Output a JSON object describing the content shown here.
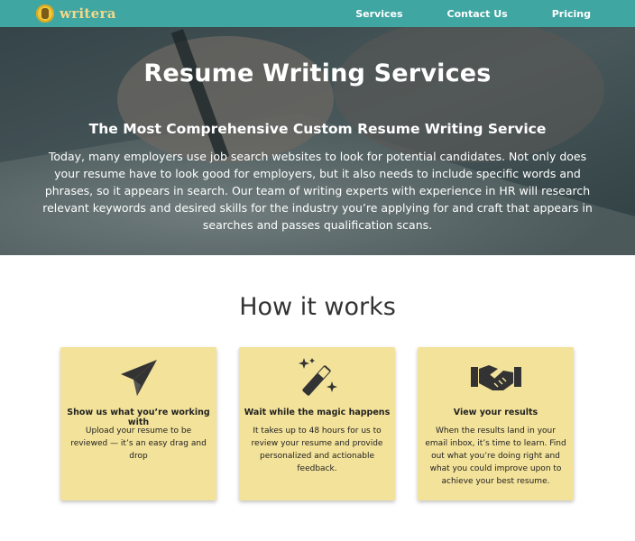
{
  "nav": {
    "logo_text": "writera",
    "links": [
      "Services",
      "Contact Us",
      "Pricing"
    ]
  },
  "hero": {
    "title": "Resume Writing Services",
    "subtitle": "The Most Comprehensive Custom Resume Writing Service",
    "body": "Today, many employers use job search websites to look for potential candidates. Not only does your resume have to look good for employers, but it also needs to include specific words and phrases, so it appears in search. Our team of writing experts with experience in HR will research relevant keywords and desired skills for the industry you’re applying for and craft that appears in searches and passes qualification scans."
  },
  "how_it_works": {
    "heading": "How it works",
    "cards": [
      {
        "icon": "paper-plane-icon",
        "title": "Show us what you’re working with",
        "text": "Upload your resume to be reviewed — it’s an easy drag and drop"
      },
      {
        "icon": "magic-wand-icon",
        "title": "Wait while the magic happens",
        "text": "It takes up to 48 hours for us to review your resume and provide personalized and actionable feedback."
      },
      {
        "icon": "handshake-icon",
        "title": "View your results",
        "text": "When the results land in your email inbox, it’s time to learn. Find out what you’re doing right and what you could improve upon to achieve your best resume."
      }
    ]
  },
  "colors": {
    "nav_bg": "#40a6a2",
    "card_bg": "#f3e29a",
    "icon": "#333333"
  }
}
